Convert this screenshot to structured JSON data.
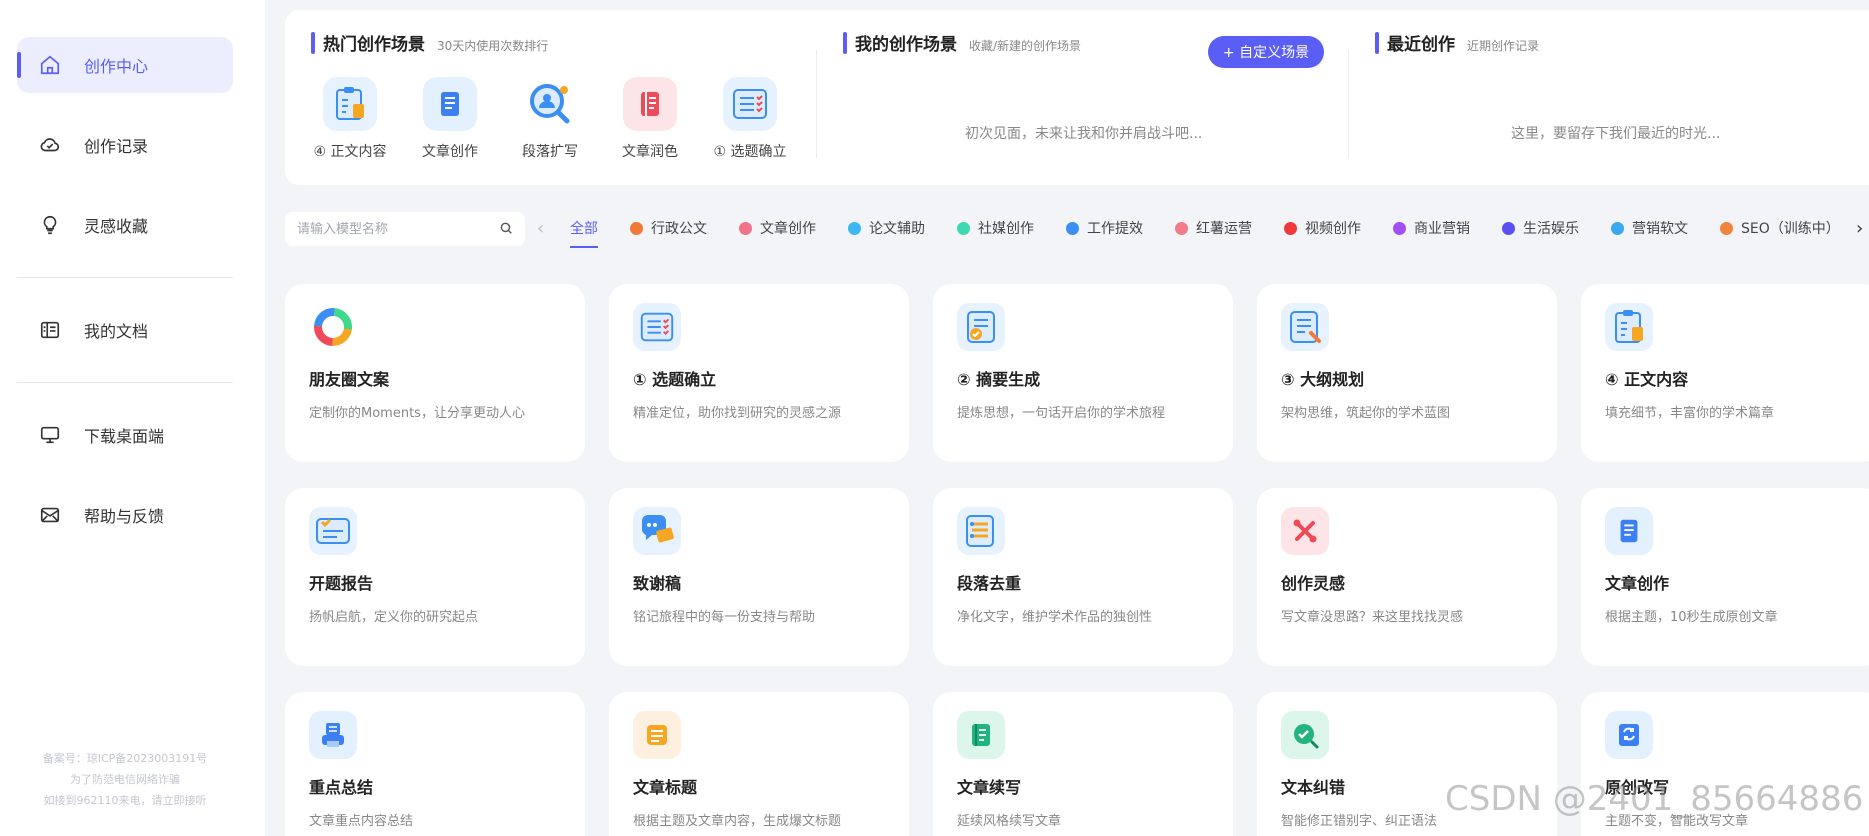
{
  "sidebar": {
    "items": [
      {
        "label": "创作中心",
        "icon": "home-icon"
      },
      {
        "label": "创作记录",
        "icon": "cloud-icon"
      },
      {
        "label": "灵感收藏",
        "icon": "lightbulb-icon"
      },
      {
        "label": "我的文档",
        "icon": "document-icon"
      },
      {
        "label": "下载桌面端",
        "icon": "monitor-icon"
      },
      {
        "label": "帮助与反馈",
        "icon": "mail-icon"
      }
    ],
    "footer": [
      "备案号：琼ICP备2023003191号",
      "为了防范电信网络诈骗",
      "如接到962110来电，请立即接听"
    ]
  },
  "hot": {
    "title": "热门创作场景",
    "subtitle": "30天内使用次数排行",
    "items": [
      {
        "label": "④ 正文内容",
        "icon": "clipboard-note-icon"
      },
      {
        "label": "文章创作",
        "icon": "book-icon"
      },
      {
        "label": "段落扩写",
        "icon": "magnifier-user-icon"
      },
      {
        "label": "文章润色",
        "icon": "red-book-icon"
      },
      {
        "label": "① 选题确立",
        "icon": "checklist-icon"
      }
    ]
  },
  "mine": {
    "title": "我的创作场景",
    "subtitle": "收藏/新建的创作场景",
    "button": "+ 自定义场景",
    "empty": "初次见面，未来让我和你并肩战斗吧..."
  },
  "recent": {
    "title": "最近创作",
    "subtitle": "近期创作记录",
    "empty": "这里，要留存下我们最近的时光..."
  },
  "search": {
    "placeholder": "请输入模型名称"
  },
  "tabs": [
    {
      "label": "全部",
      "color": ""
    },
    {
      "label": "行政公文",
      "color": "#f07a3a"
    },
    {
      "label": "文章创作",
      "color": "#f0738a"
    },
    {
      "label": "论文辅助",
      "color": "#3bb8f2"
    },
    {
      "label": "社媒创作",
      "color": "#3ed9b2"
    },
    {
      "label": "工作提效",
      "color": "#3b8ef2"
    },
    {
      "label": "红薯运营",
      "color": "#f27a8a"
    },
    {
      "label": "视频创作",
      "color": "#f03a3a"
    },
    {
      "label": "商业营销",
      "color": "#a24ef2"
    },
    {
      "label": "生活娱乐",
      "color": "#5b4ef2"
    },
    {
      "label": "营销软文",
      "color": "#3ba8f2"
    },
    {
      "label": "SEO（训练中）",
      "color": "#f0843a"
    }
  ],
  "cards": [
    {
      "title": "朋友圈文案",
      "desc": "定制你的Moments，让分享更动人心",
      "icon": "color-ring-icon"
    },
    {
      "title": "① 选题确立",
      "desc": "精准定位，助你找到研究的灵感之源",
      "icon": "checklist-icon"
    },
    {
      "title": "② 摘要生成",
      "desc": "提炼思想，一句话开启你的学术旅程",
      "icon": "document-check-icon"
    },
    {
      "title": "③ 大纲规划",
      "desc": "架构思维，筑起你的学术蓝图",
      "icon": "document-edit-icon"
    },
    {
      "title": "④ 正文内容",
      "desc": "填充细节，丰富你的学术篇章",
      "icon": "clipboard-note-icon"
    },
    {
      "title": "开题报告",
      "desc": "扬帆启航，定义你的研究起点",
      "icon": "report-icon"
    },
    {
      "title": "致谢稿",
      "desc": "铭记旅程中的每一份支持与帮助",
      "icon": "chat-bubble-icon"
    },
    {
      "title": "段落去重",
      "desc": "净化文字，维护学术作品的独创性",
      "icon": "list-dedupe-icon"
    },
    {
      "title": "创作灵感",
      "desc": "写文章没思路？来这里找找灵感",
      "icon": "tools-icon"
    },
    {
      "title": "文章创作",
      "desc": "根据主题，10秒生成原创文章",
      "icon": "book-icon"
    },
    {
      "title": "重点总结",
      "desc": "文章重点内容总结",
      "icon": "printer-icon"
    },
    {
      "title": "文章标题",
      "desc": "根据主题及文章内容，生成爆文标题",
      "icon": "title-doc-icon"
    },
    {
      "title": "文章续写",
      "desc": "延续风格续写文章",
      "icon": "notebook-icon"
    },
    {
      "title": "文本纠错",
      "desc": "智能修正错别字、纠正语法",
      "icon": "check-search-icon"
    },
    {
      "title": "原创改写",
      "desc": "主题不变，智能改写文章",
      "icon": "refresh-doc-icon"
    }
  ],
  "watermark": "CSDN @2401_85664886"
}
